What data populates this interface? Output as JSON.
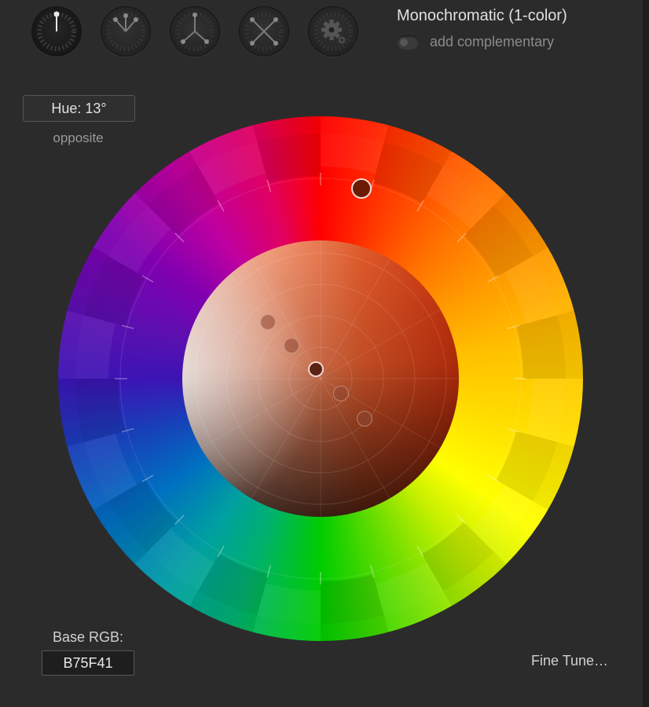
{
  "modes": [
    {
      "icon": "monochromatic-mode-icon",
      "active": true
    },
    {
      "icon": "triad-mode-icon",
      "active": false
    },
    {
      "icon": "split-mode-icon",
      "active": false
    },
    {
      "icon": "tetrad-mode-icon",
      "active": false
    },
    {
      "icon": "custom-mode-gear-icon",
      "active": false
    }
  ],
  "scheme": {
    "title": "Monochromatic (1-color)",
    "complementary_label": "add complementary",
    "complementary_enabled": false
  },
  "hue": {
    "label": "Hue: 13°",
    "opposite_link": "opposite"
  },
  "base": {
    "label": "Base RGB:",
    "value": "B75F41"
  },
  "fine_tune": "Fine Tune…",
  "colors": {
    "base": "#B75F41",
    "panel_bg": "#2b2b2b"
  }
}
